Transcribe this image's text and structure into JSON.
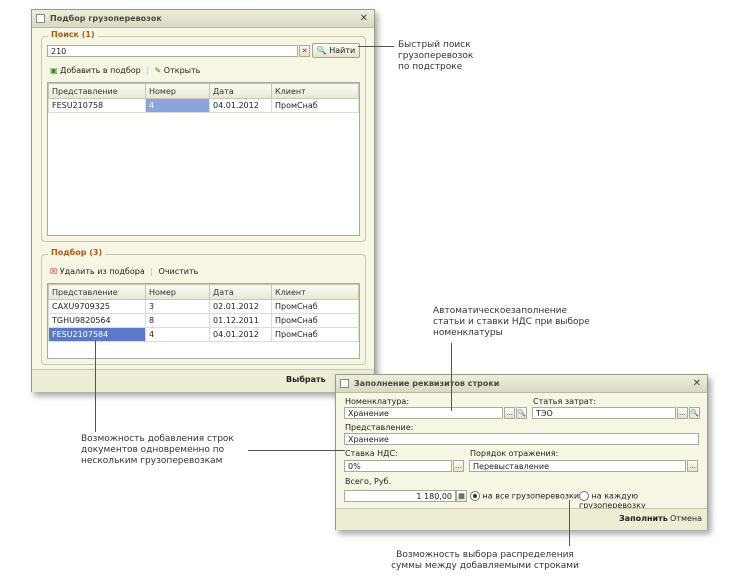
{
  "main_window": {
    "title": "Подбор грузоперевозок",
    "search_group": {
      "title": "Поиск (1)",
      "search_value": "210",
      "find_label": "Найти",
      "add_label": "Добавить в подбор",
      "open_label": "Открыть",
      "columns": [
        "Представление",
        "Номер",
        "Дата",
        "Клиент"
      ],
      "rows": [
        [
          "FESU210758",
          "4",
          "04.01.2012",
          "ПромСнаб"
        ]
      ]
    },
    "selection_group": {
      "title": "Подбор (3)",
      "remove_label": "Удалить из подбора",
      "clear_label": "Очистить",
      "columns": [
        "Представление",
        "Номер",
        "Дата",
        "Клиент"
      ],
      "rows": [
        [
          "CAXU9709325",
          "3",
          "02.01.2012",
          "ПромСнаб"
        ],
        [
          "TGHU9820564",
          "8",
          "01.12.2011",
          "ПромСнаб"
        ],
        [
          "FESU2107584",
          "4",
          "04.01.2012",
          "ПромСнаб"
        ]
      ]
    },
    "select_label": "Выбрать"
  },
  "dialog": {
    "title": "Заполнение реквизитов строки",
    "nomenclature_label": "Номенклатура:",
    "nomenclature_value": "Хранение",
    "cost_item_label": "Статья затрат:",
    "cost_item_value": "ТЭО",
    "representation_label": "Представление:",
    "representation_value": "Хранение",
    "vat_label": "Ставка НДС:",
    "vat_value": "0%",
    "reflection_label": "Порядок отражения:",
    "reflection_value": "Перевыставление",
    "total_label": "Всего, Руб.",
    "total_value": "1 180,00",
    "radio_all": "на все грузоперевозки",
    "radio_each": "на каждую грузоперевозку",
    "fill_label": "Заполнить",
    "cancel_label": "Отмена"
  },
  "annotations": {
    "search": [
      "Быстрый поиск",
      "грузоперевозок",
      "по подстроке"
    ],
    "autofill": [
      "Автоматическоезаполнение",
      "статьи и ставки НДС при выборе",
      "номенклатуры"
    ],
    "multi": [
      "Возможность добавления строк",
      "документов одновременно по",
      "нескольким грузоперевозкам"
    ],
    "distribution": [
      "Возможность выбора распределения",
      "суммы между добавляемыми строками"
    ]
  }
}
